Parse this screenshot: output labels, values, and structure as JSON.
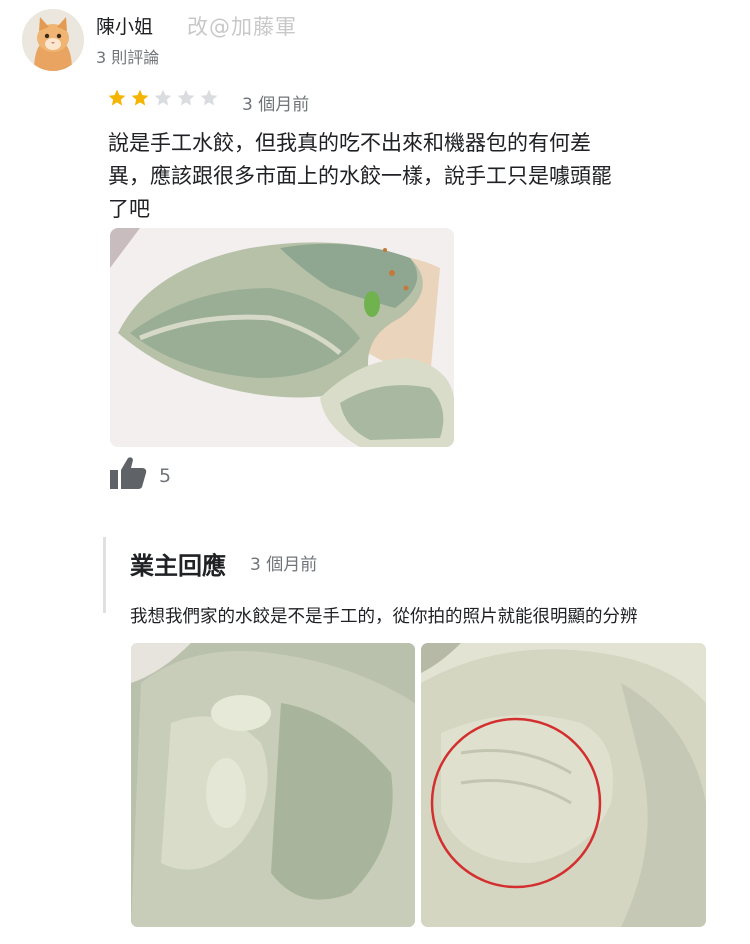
{
  "review": {
    "reviewer_name": "陳小姐",
    "watermark": "改@加藤軍",
    "review_count": "3 則評論",
    "rating": 2,
    "rating_max": 5,
    "time": "3 個月前",
    "text": "說是手工水餃，但我真的吃不出來和機器包的有何差\n異，應該跟很多市面上的水餃一樣，說手工只是噱頭罷\n了吧",
    "like_count": "5"
  },
  "owner_response": {
    "title": "業主回應",
    "time": "3 個月前",
    "text": "我想我們家的水餃是不是手工的，從你拍的照片就能很明顯的分辨"
  },
  "colors": {
    "star_filled": "#f4b400",
    "star_empty": "#dadce0",
    "highlight_circle": "#d32f2f"
  },
  "icons": {
    "like": "thumbs-up-icon"
  }
}
